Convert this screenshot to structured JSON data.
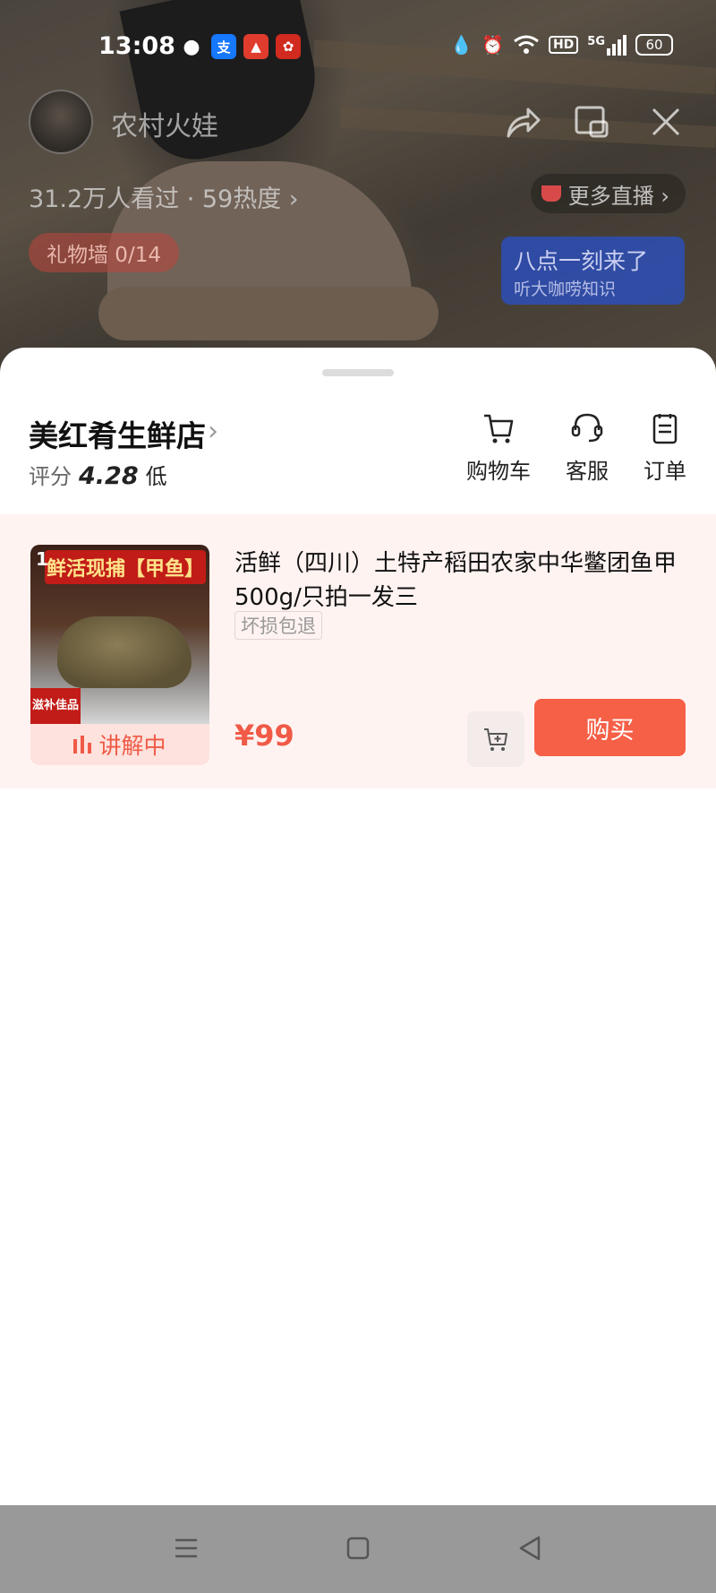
{
  "status_bar": {
    "time": "13:08",
    "network": "5G",
    "hd": "HD",
    "battery": "60"
  },
  "stream": {
    "streamer_name": "农村火娃",
    "stats": "31.2万人看过 · 59热度 ›",
    "more_live": "更多直播 ›",
    "gift_wall": "礼物墙 0/14",
    "promo_line1": "八点一刻来了",
    "promo_line2": "听大咖唠知识"
  },
  "shop": {
    "name": "美红肴生鲜店",
    "rating_label": "评分",
    "rating_score": "4.28",
    "rating_level": "低",
    "actions": {
      "cart": "购物车",
      "service": "客服",
      "orders": "订单"
    }
  },
  "product": {
    "index": "1",
    "thumb_title": "鲜活现捕【甲鱼】",
    "thumb_tag": "滋补佳品",
    "explaining": "讲解中",
    "title": "活鲜（四川）土特产稻田农家中华鳖团鱼甲500g/只拍一发三",
    "tag": "坏损包退",
    "price": "¥99",
    "buy_label": "购买"
  },
  "colors": {
    "accent": "#f56047",
    "product_row_bg": "#fff3f1",
    "nav_bar": "#999999"
  }
}
